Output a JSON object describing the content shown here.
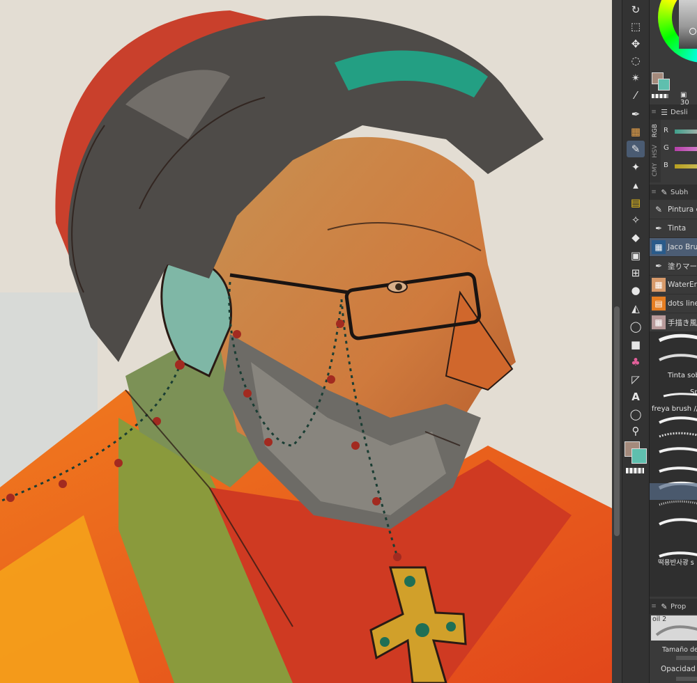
{
  "toolbar": {
    "tools": [
      {
        "name": "rotate-tool-icon",
        "glyph": "↻"
      },
      {
        "name": "object-tool-icon",
        "glyph": "⬚"
      },
      {
        "name": "move-tool-icon",
        "glyph": "✥"
      },
      {
        "name": "lasso-tool-icon",
        "glyph": "◌"
      },
      {
        "name": "magic-wand-tool-icon",
        "glyph": "✴"
      },
      {
        "name": "eyedropper-tool-icon",
        "glyph": "⁄"
      },
      {
        "name": "pen-tool-icon",
        "glyph": "✒"
      },
      {
        "name": "brush-thumbnail-icon",
        "glyph": "▦"
      },
      {
        "name": "brush-tool-icon",
        "glyph": "✎"
      },
      {
        "name": "sparkle-tool-icon",
        "glyph": "✦"
      },
      {
        "name": "spray-tool-icon",
        "glyph": "▴"
      },
      {
        "name": "jaco-brush-icon",
        "glyph": "▤"
      },
      {
        "name": "decoration-tool-icon",
        "glyph": "✧"
      },
      {
        "name": "eraser-tool-icon",
        "glyph": "◆"
      },
      {
        "name": "frame-tool-icon",
        "glyph": "▣"
      },
      {
        "name": "grid-tool-icon",
        "glyph": "⊞"
      },
      {
        "name": "blend-tool-icon",
        "glyph": "●"
      },
      {
        "name": "fill-tool-icon",
        "glyph": "◭"
      },
      {
        "name": "selection-tool-icon",
        "glyph": "◯"
      },
      {
        "name": "gradient-tool-icon",
        "glyph": "■"
      },
      {
        "name": "cake-brush-icon",
        "glyph": "♣"
      },
      {
        "name": "figure-tool-icon",
        "glyph": "◸"
      },
      {
        "name": "text-tool-icon",
        "glyph": "A"
      },
      {
        "name": "balloon-tool-icon",
        "glyph": "◯"
      },
      {
        "name": "correction-tool-icon",
        "glyph": "⚲"
      }
    ],
    "colors": {
      "main": "#a48a7c",
      "sub": "#5fbfae"
    }
  },
  "color_panel": {
    "size_label": "30",
    "rgb": {
      "tabs": [
        "RGB",
        "HSV",
        "CMY"
      ],
      "labels": [
        "R",
        "G",
        "B"
      ],
      "header": "Desli"
    },
    "swatch_main": "#a48a7c",
    "swatch_sub": "#5fbfae"
  },
  "subtool": {
    "header": "Subh",
    "items": [
      {
        "label": "Pintura e",
        "icon": "brush-icon",
        "glyph": "✎"
      },
      {
        "label": "Tinta",
        "icon": "ink-pen-icon",
        "glyph": "✒"
      },
      {
        "label": "Jaco Bru",
        "icon": "jaco-brush-thumb-icon",
        "glyph": "▦",
        "selected": true
      },
      {
        "label": "塗りマー",
        "icon": "marker-icon",
        "glyph": "✒"
      },
      {
        "label": "WaterEr",
        "icon": "watercolor-thumb-icon",
        "glyph": "▦"
      },
      {
        "label": "dots line",
        "icon": "dots-thumb-icon",
        "glyph": "▤"
      },
      {
        "label": "手描き風",
        "icon": "hand-drawn-thumb-icon",
        "glyph": "▦"
      }
    ]
  },
  "brushes": {
    "labels": [
      "Tinta sob",
      "Sp",
      "freya brush //",
      "떡용반사광 s"
    ]
  },
  "properties": {
    "header": "Prop",
    "brush_name": "oil 2",
    "size_label": "Tamaño del p",
    "opacity_label": "Opacidad"
  }
}
